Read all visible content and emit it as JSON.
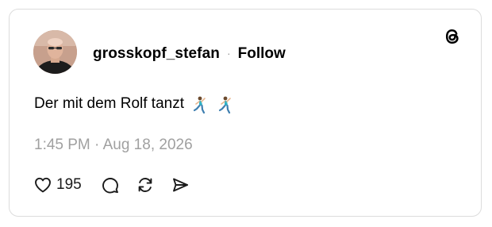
{
  "post": {
    "username": "grosskopf_stefan",
    "separator": "·",
    "follow_label": "Follow",
    "text": "Der mit dem Rolf tanzt",
    "emojis": [
      "dancing-man-emoji",
      "dancing-man-emoji"
    ],
    "timestamp": "1:45 PM · Aug 18, 2026",
    "like_count": "195"
  },
  "icons": {
    "logo": "threads-logo-icon",
    "like": "heart-icon",
    "reply": "comment-icon",
    "repost": "repost-icon",
    "share": "share-icon"
  },
  "colors": {
    "text": "#000000",
    "muted": "#a0a0a0",
    "border": "#dcdcdc",
    "background": "#ffffff"
  }
}
